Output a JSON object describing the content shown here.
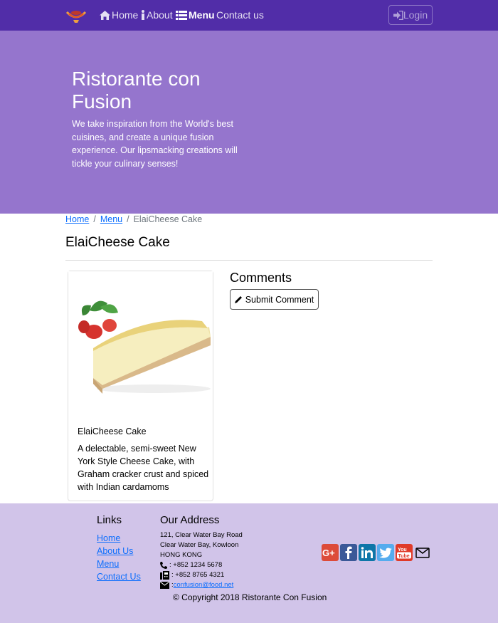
{
  "nav": {
    "home": "Home",
    "about": "About",
    "menu": "Menu",
    "contact": "Contact us",
    "login": "Login"
  },
  "jumbotron": {
    "title": "Ristorante con Fusion",
    "text": "We take inspiration from the World's best cuisines, and create a unique fusion experience. Our lipsmacking creations will tickle your culinary senses!"
  },
  "breadcrumb": {
    "home": "Home",
    "menu": "Menu",
    "current": "ElaiCheese Cake",
    "separator": "/"
  },
  "dish": {
    "page_title": "ElaiCheese Cake",
    "name": "ElaiCheese Cake",
    "description": "A delectable, semi-sweet New York Style Cheese Cake, with Graham cracker crust and spiced with Indian cardamoms"
  },
  "comments": {
    "title": "Comments",
    "submit_label": "Submit Comment"
  },
  "footer": {
    "links_title": "Links",
    "links": [
      "Home",
      "About Us",
      "Menu",
      "Contact Us"
    ],
    "address_title": "Our Address",
    "address_lines": [
      "121, Clear Water Bay Road",
      "Clear Water Bay, Kowloon",
      "HONG KONG"
    ],
    "phone": ": +852 1234 5678",
    "fax": ": +852 8765 4321",
    "email_prefix": ": ",
    "email": "confusion@food.net",
    "copyright": "© Copyright 2018 Ristorante Con Fusion",
    "social_icons": [
      "google-plus-icon",
      "facebook-icon",
      "linkedin-icon",
      "twitter-icon",
      "youtube-icon",
      "mail-icon"
    ]
  },
  "colors": {
    "navbar": "#512da8",
    "jumbotron": "#9575cd",
    "footer": "#d1c4e9",
    "link": "#0d6efd"
  }
}
